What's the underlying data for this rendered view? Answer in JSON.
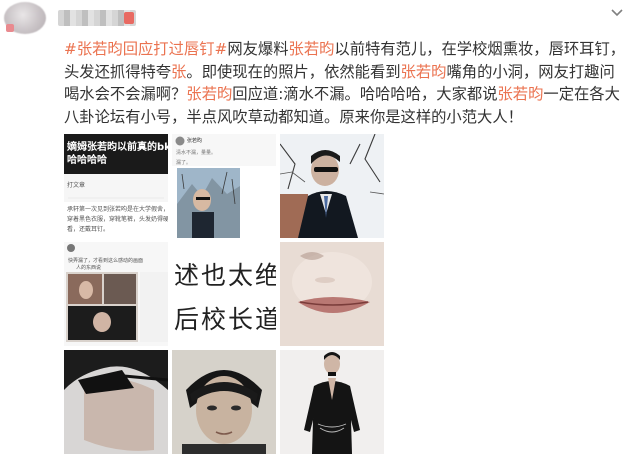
{
  "post": {
    "topic_tag": "#张若昀回应打过唇钉#",
    "text_1": "网友爆料",
    "name_1": "张若昀",
    "text_2": "以前特有范儿，在学校烟熏妆，唇环耳钉，头发还抓得特夸",
    "name_short": "张",
    "text_3": "。即使现在的照片，依然能看到",
    "name_2": "张若昀",
    "text_4": "嘴角的小洞，网友打趣问喝水会不会漏啊？",
    "name_3": "张若昀",
    "text_5": "回应道:滴水不漏。哈哈哈哈，大家都说",
    "name_4": "张若昀",
    "text_6": "一定在各大八卦论坛有小号，半点风吹草动都知道。原来你是这样的小范大人！"
  },
  "images": {
    "img1": {
      "title_line1": "嫡姆张若昀以前真的bking吧",
      "title_line2": "哈哈哈哈",
      "small_1": "打文章",
      "small_2": "承轩第一次见到张若昀是在大学假舍，",
      "small_3": "穿着黑色衣服，穿靴笔裤，头发奶得硬邦",
      "small_4": "看，还戴耳钉。"
    },
    "img2": {
      "name": "张若昀",
      "sub": "清水不漏，量量。",
      "caption": "漏了。"
    },
    "img4": {
      "reply_1": "快弄漏了，才看到这么感动的画面",
      "reply_2": "人的东西说"
    },
    "img5": {
      "text_line1": "述也太绝",
      "text_line2": "后校长道"
    }
  },
  "colors": {
    "highlight": "#eb7350",
    "text": "#333333"
  },
  "icons": {
    "menu": "chevron-down-icon"
  }
}
